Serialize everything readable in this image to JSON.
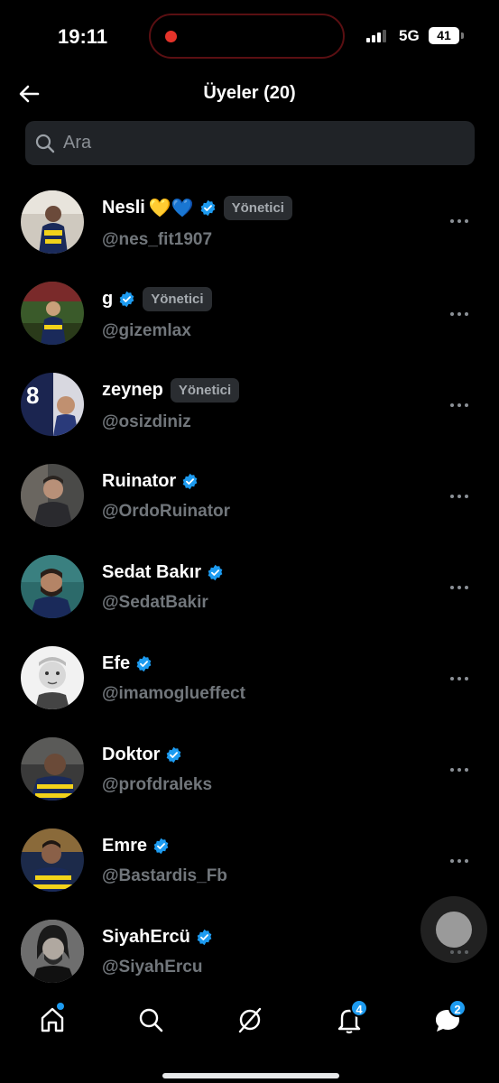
{
  "status_bar": {
    "time": "19:11",
    "network": "5G",
    "battery": "41"
  },
  "header": {
    "title": "Üyeler (20)"
  },
  "search": {
    "placeholder": "Ara"
  },
  "members": [
    {
      "name": "Nesli",
      "emoji": "💛💙",
      "verified": true,
      "role": "Yönetici",
      "handle": "@nes_fit1907"
    },
    {
      "name": "g",
      "emoji": "",
      "verified": true,
      "role": "Yönetici",
      "handle": "@gizemlax"
    },
    {
      "name": "zeynep",
      "emoji": "",
      "verified": false,
      "role": "Yönetici",
      "handle": "@osizdiniz"
    },
    {
      "name": "Ruinator",
      "emoji": "",
      "verified": true,
      "role": "",
      "handle": "@OrdoRuinator"
    },
    {
      "name": "Sedat Bakır",
      "emoji": "",
      "verified": true,
      "role": "",
      "handle": "@SedatBakir"
    },
    {
      "name": "Efe",
      "emoji": "",
      "verified": true,
      "role": "",
      "handle": "@imamoglueffect"
    },
    {
      "name": "Doktor",
      "emoji": "",
      "verified": true,
      "role": "",
      "handle": "@profdraleks"
    },
    {
      "name": "Emre",
      "emoji": "",
      "verified": true,
      "role": "",
      "handle": "@Bastardis_Fb"
    },
    {
      "name": "SiyahErcü",
      "emoji": "",
      "verified": true,
      "role": "",
      "handle": "@SiyahErcu"
    }
  ],
  "bottom_nav": {
    "items": [
      {
        "icon": "home-icon",
        "badge": ""
      },
      {
        "icon": "search-icon",
        "badge": ""
      },
      {
        "icon": "grok-icon",
        "badge": ""
      },
      {
        "icon": "bell-icon",
        "badge": "4"
      },
      {
        "icon": "messages-icon",
        "badge": "2"
      }
    ]
  },
  "colors": {
    "accent": "#1d9bf0",
    "background": "#000000",
    "muted": "#71767b"
  }
}
